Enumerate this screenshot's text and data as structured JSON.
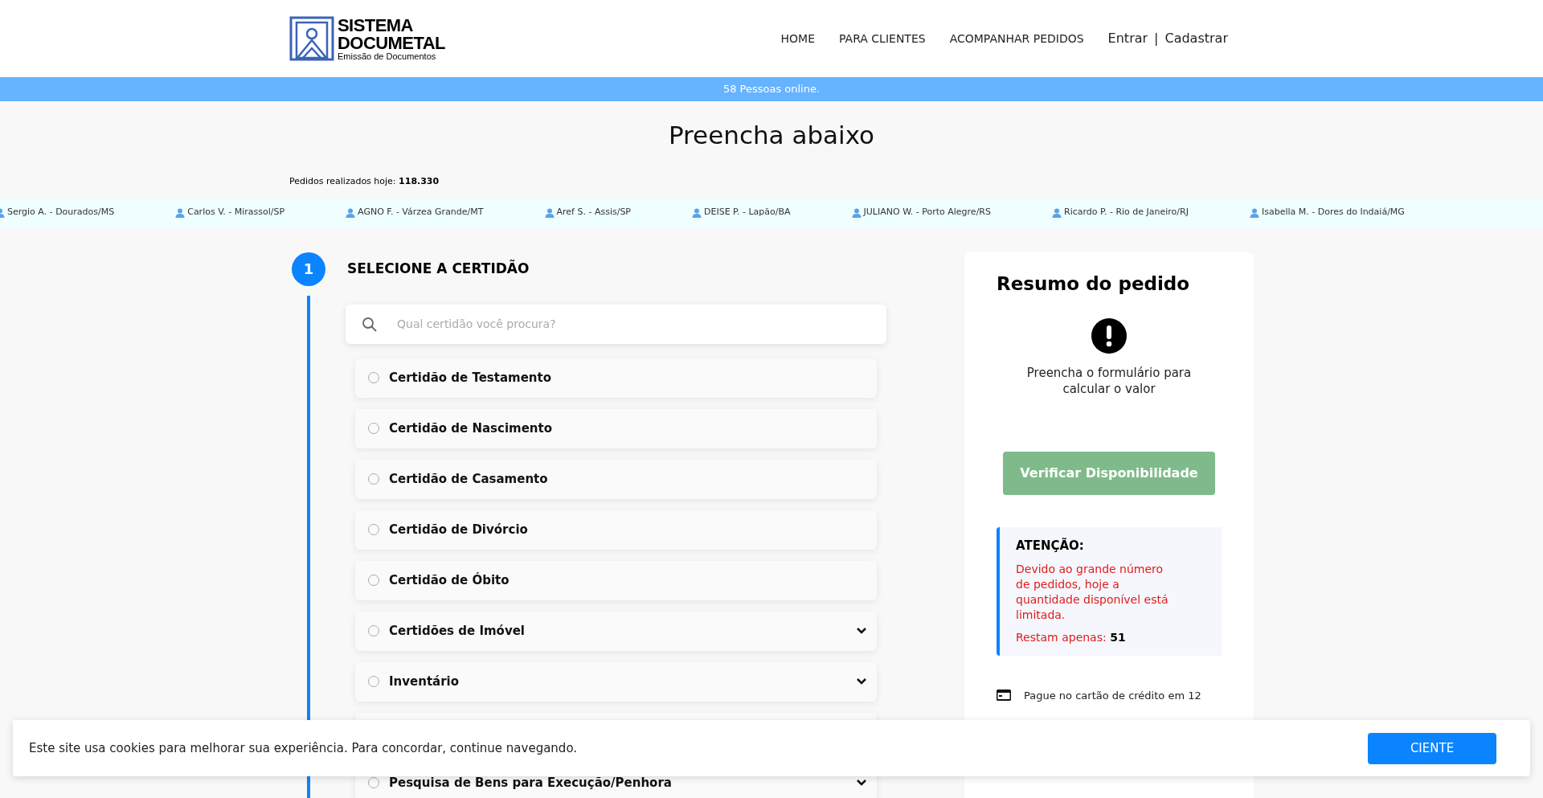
{
  "header": {
    "logo": {
      "title_line_1": "SISTEMA",
      "title_line_2": "DOCUMETAL",
      "subtitle": "Emissão de Documentos"
    },
    "nav": [
      {
        "label": "HOME"
      },
      {
        "label": "PARA CLIENTES"
      },
      {
        "label": "ACOMPANHAR PEDIDOS"
      }
    ],
    "auth": {
      "login": "Entrar",
      "separator": "|",
      "register": "Cadastrar"
    }
  },
  "online_bar": "58 Pessoas online.",
  "page_title": "Preencha abaixo",
  "orders_today": {
    "label": "Pedidos realizados hoje:",
    "value": "118.330"
  },
  "ticker": [
    "Sergio A. - Dourados/MS",
    "Carlos V. - Mirassol/SP",
    "AGNO F. - Várzea Grande/MT",
    "Aref S. - Assis/SP",
    "DEISE P. - Lapão/BA",
    "JULIANO W. - Porto Alegre/RS",
    "Ricardo P. - Rio de Janeiro/RJ",
    "Isabella M. - Dores do Indaiá/MG"
  ],
  "step": {
    "number": "1",
    "title": "SELECIONE A CERTIDÃO",
    "search": {
      "placeholder": "Qual certidão você procura?"
    },
    "options": [
      {
        "label": "Certidão de Testamento",
        "kind": "plain",
        "selected": false
      },
      {
        "label": "Certidão de Nascimento",
        "kind": "plain",
        "selected": false
      },
      {
        "label": "Certidão de Casamento",
        "kind": "plain",
        "selected": false
      },
      {
        "label": "Certidão de Divórcio",
        "kind": "plain",
        "selected": false
      },
      {
        "label": "Certidão de Óbito",
        "kind": "plain",
        "selected": false
      },
      {
        "label": "Certidões de Imóvel",
        "kind": "expandable",
        "selected": false
      },
      {
        "label": "Inventário",
        "kind": "expandable",
        "selected": false
      },
      {
        "kind": "hidden"
      },
      {
        "label": "Pesquisa de Bens para Execução/Penhora",
        "kind": "expandable",
        "selected": false
      }
    ]
  },
  "summary": {
    "title": "Resumo do pedido",
    "message": "Preencha o formulário para calcular o valor",
    "button": "Verificar Disponibilidade",
    "attention": {
      "title": "ATENÇÃO:",
      "text": "Devido ao grande número de pedidos, hoje a quantidade disponível está limitada.",
      "remaining_label": "Restam apenas:",
      "remaining_value": "51"
    },
    "payment": "Pague no cartão de crédito em 12"
  },
  "cookie_banner": {
    "text": "Este site usa cookies para melhorar sua experiência. Para concordar, continue navegando.",
    "button": "CIENTE"
  }
}
